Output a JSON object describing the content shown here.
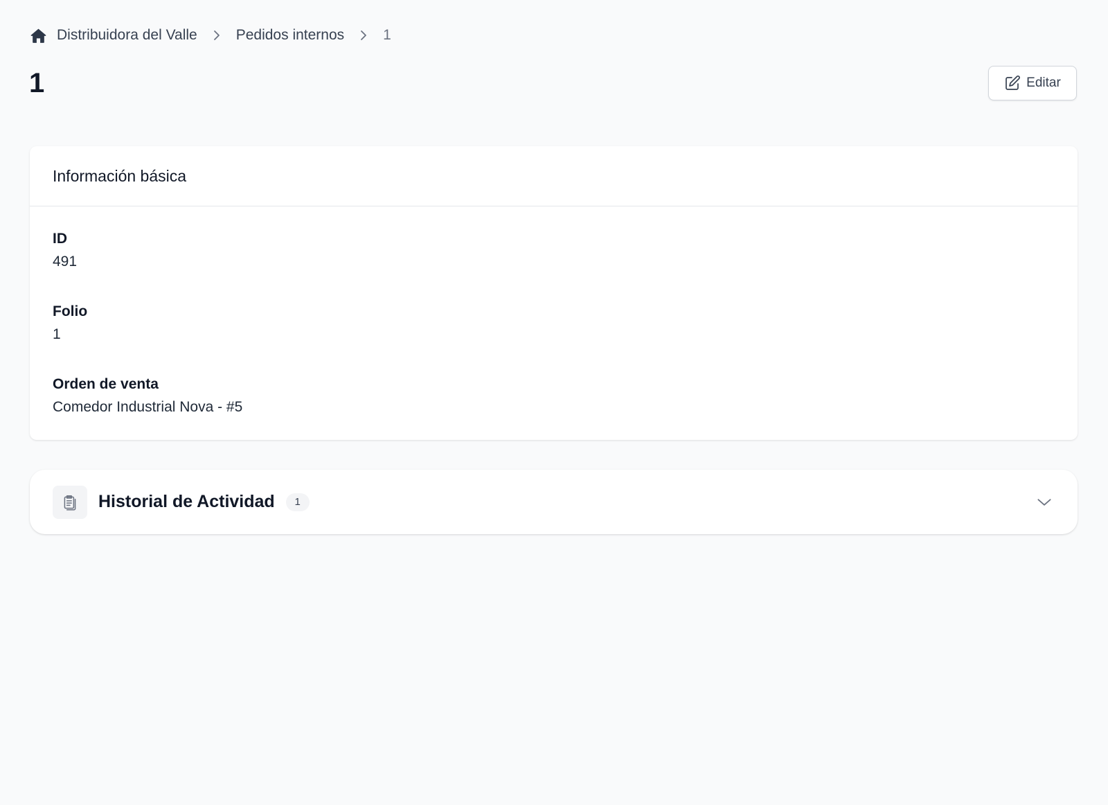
{
  "breadcrumb": {
    "home_icon": "home-icon",
    "items": [
      "Distribuidora del Valle",
      "Pedidos internos",
      "1"
    ]
  },
  "header": {
    "title": "1",
    "edit_label": "Editar",
    "edit_icon": "pencil-square-icon"
  },
  "basic_info": {
    "title": "Información básica",
    "fields": [
      {
        "label": "ID",
        "value": "491"
      },
      {
        "label": "Folio",
        "value": "1"
      },
      {
        "label": "Orden de venta",
        "value": "Comedor Industrial Nova - #5"
      }
    ]
  },
  "activity": {
    "icon": "clipboard-icon",
    "title": "Historial de Actividad",
    "count": "1",
    "toggle_icon": "chevron-down-icon"
  },
  "colors": {
    "background": "#f9fafb",
    "card": "#ffffff",
    "text": "#111827",
    "muted": "#6b7280",
    "border": "#e5e7eb"
  }
}
